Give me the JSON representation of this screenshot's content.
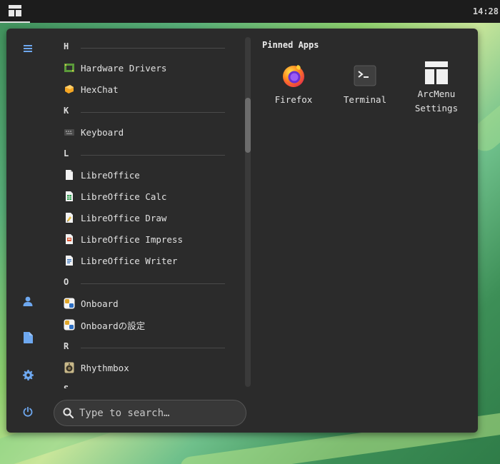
{
  "topbar": {
    "clock": "14:28",
    "menu_button_icon": "arcmenu-layout-icon"
  },
  "sidebar": {
    "buttons": [
      {
        "name": "hamburger-menu-icon"
      },
      {
        "name": "user-icon"
      },
      {
        "name": "document-icon"
      },
      {
        "name": "settings-gear-icon"
      },
      {
        "name": "power-icon"
      }
    ],
    "accent": "#6ea8f0"
  },
  "apps_list": {
    "rows": [
      {
        "type": "section",
        "label": "H"
      },
      {
        "type": "app",
        "label": "Hardware Drivers",
        "icon": "chip-icon"
      },
      {
        "type": "app",
        "label": "HexChat",
        "icon": "hexchat-icon"
      },
      {
        "type": "section",
        "label": "K"
      },
      {
        "type": "app",
        "label": "Keyboard",
        "icon": "keyboard-icon"
      },
      {
        "type": "section",
        "label": "L"
      },
      {
        "type": "app",
        "label": "LibreOffice",
        "icon": "libreoffice-icon"
      },
      {
        "type": "app",
        "label": "LibreOffice Calc",
        "icon": "libreoffice-calc-icon"
      },
      {
        "type": "app",
        "label": "LibreOffice Draw",
        "icon": "libreoffice-draw-icon"
      },
      {
        "type": "app",
        "label": "LibreOffice Impress",
        "icon": "libreoffice-impress-icon"
      },
      {
        "type": "app",
        "label": "LibreOffice Writer",
        "icon": "libreoffice-writer-icon"
      },
      {
        "type": "section",
        "label": "O"
      },
      {
        "type": "app",
        "label": "Onboard",
        "icon": "onboard-icon"
      },
      {
        "type": "app",
        "label": "Onboardの設定",
        "icon": "onboard-settings-icon"
      },
      {
        "type": "section",
        "label": "R"
      },
      {
        "type": "app",
        "label": "Rhythmbox",
        "icon": "rhythmbox-icon"
      },
      {
        "type": "section",
        "label": "S"
      }
    ]
  },
  "search": {
    "placeholder": "Type to search…"
  },
  "pinned": {
    "title": "Pinned Apps",
    "apps": [
      {
        "label": "Firefox",
        "icon": "firefox-icon"
      },
      {
        "label": "Terminal",
        "icon": "terminal-icon"
      },
      {
        "label": "ArcMenu\nSettings",
        "icon": "arcmenu-settings-icon"
      }
    ]
  }
}
